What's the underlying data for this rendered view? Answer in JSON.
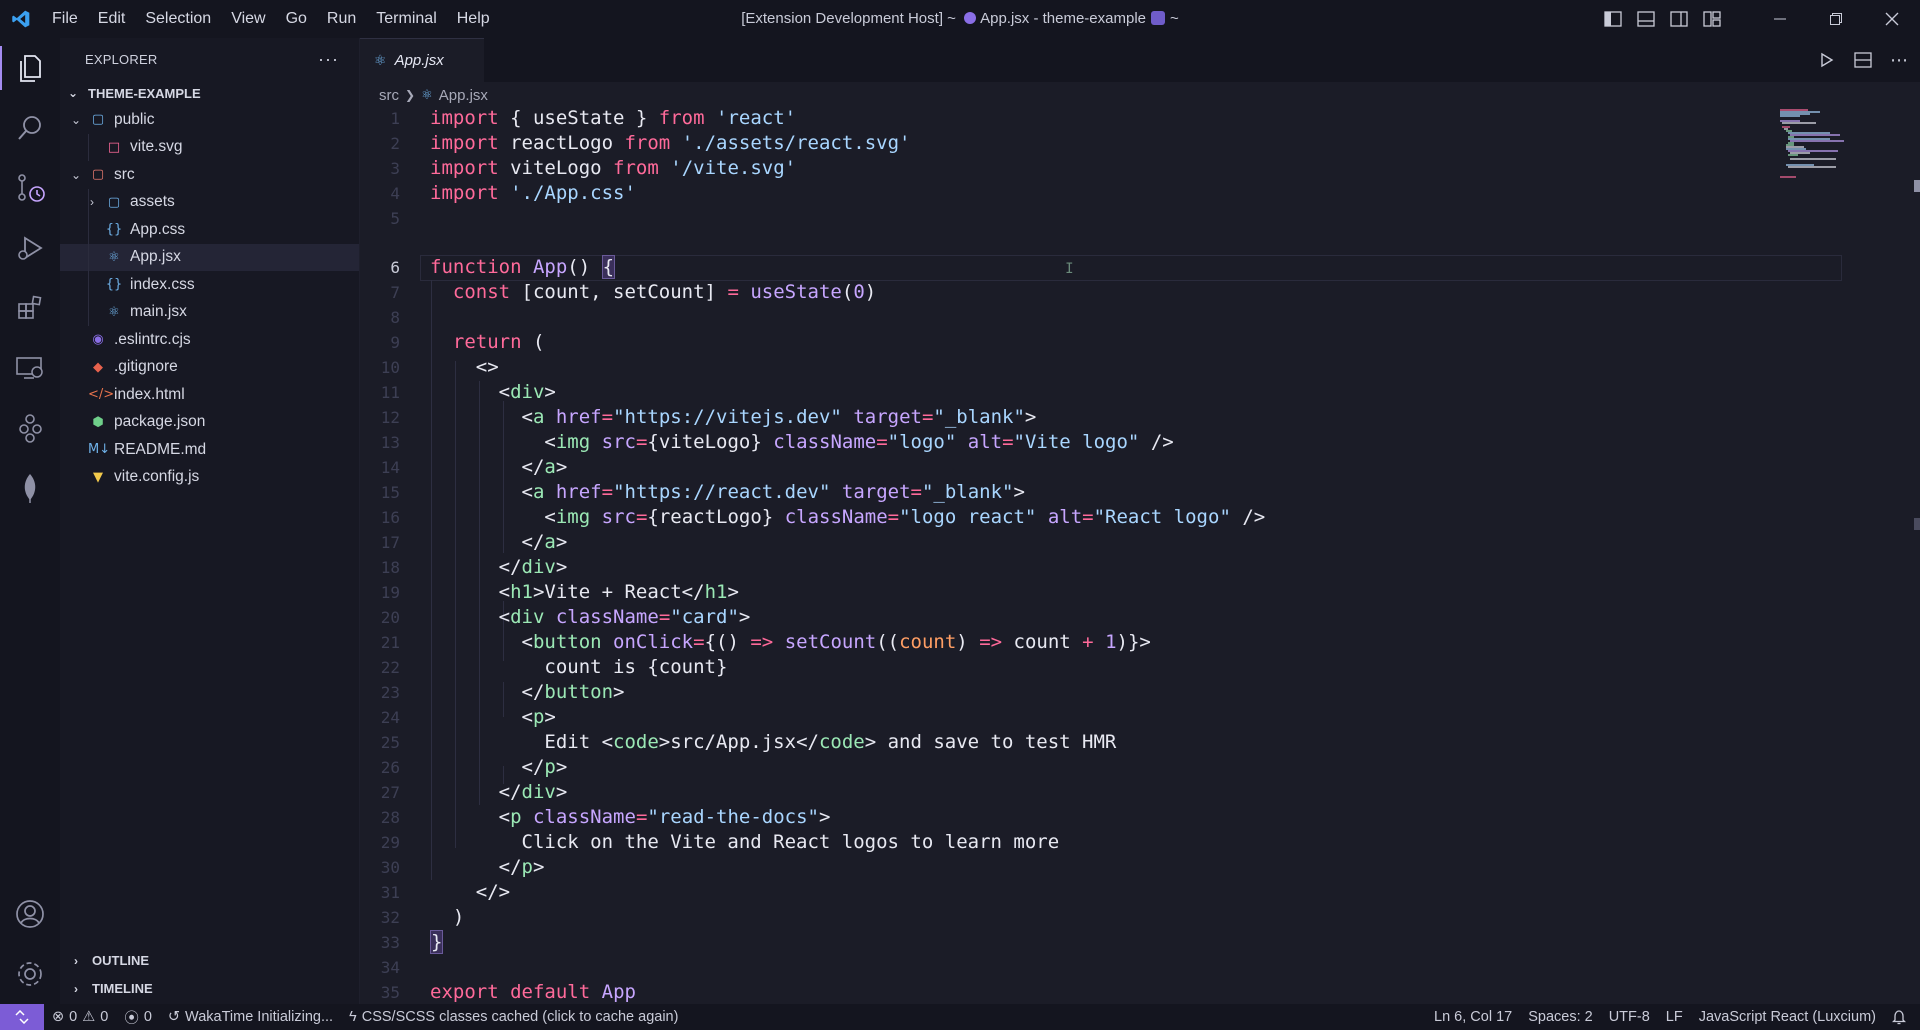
{
  "titlebar": {
    "menu": [
      "File",
      "Edit",
      "Selection",
      "View",
      "Go",
      "Run",
      "Terminal",
      "Help"
    ],
    "title_prefix": "[Extension Development Host] ~",
    "title_main": "App.jsx - theme-example",
    "title_suffix": "~"
  },
  "sidebar": {
    "title": "EXPLORER",
    "more": "···",
    "folder": "THEME-EXAMPLE",
    "tree": [
      {
        "label": "public",
        "kind": "folder-open",
        "depth": 1,
        "icon": "folder-icon"
      },
      {
        "label": "vite.svg",
        "kind": "file",
        "depth": 2,
        "icon": "svg-file-icon"
      },
      {
        "label": "src",
        "kind": "folder-open",
        "depth": 1,
        "icon": "src-folder-icon"
      },
      {
        "label": "assets",
        "kind": "folder-closed",
        "depth": 2,
        "icon": "folder-icon"
      },
      {
        "label": "App.css",
        "kind": "file",
        "depth": 2,
        "icon": "css-file-icon"
      },
      {
        "label": "App.jsx",
        "kind": "file",
        "depth": 2,
        "icon": "react-file-icon",
        "selected": true
      },
      {
        "label": "index.css",
        "kind": "file",
        "depth": 2,
        "icon": "css-file-icon"
      },
      {
        "label": "main.jsx",
        "kind": "file",
        "depth": 2,
        "icon": "react-file-icon"
      },
      {
        "label": ".eslintrc.cjs",
        "kind": "file",
        "depth": 1,
        "icon": "eslint-file-icon"
      },
      {
        "label": ".gitignore",
        "kind": "file",
        "depth": 1,
        "icon": "git-file-icon"
      },
      {
        "label": "index.html",
        "kind": "file",
        "depth": 1,
        "icon": "html-file-icon"
      },
      {
        "label": "package.json",
        "kind": "file",
        "depth": 1,
        "icon": "node-file-icon"
      },
      {
        "label": "README.md",
        "kind": "file",
        "depth": 1,
        "icon": "markdown-file-icon"
      },
      {
        "label": "vite.config.js",
        "kind": "file",
        "depth": 1,
        "icon": "vite-file-icon"
      }
    ],
    "outline": "OUTLINE",
    "timeline": "TIMELINE"
  },
  "editor": {
    "tab": "App.jsx",
    "breadcrumb": [
      "src",
      "App.jsx"
    ],
    "current_line": 6,
    "line_numbers": [
      "1",
      "2",
      "3",
      "4",
      "5",
      "6",
      "7",
      "8",
      "9",
      "10",
      "11",
      "12",
      "13",
      "14",
      "15",
      "16",
      "17",
      "18",
      "19",
      "20",
      "21",
      "22",
      "23",
      "24",
      "25",
      "26",
      "27",
      "28",
      "29",
      "30",
      "31",
      "32",
      "33",
      "34",
      "35"
    ]
  },
  "statusbar": {
    "errors": "0",
    "warnings": "0",
    "ports": "0",
    "wakatime": "WakaTime Initializing...",
    "css_cache": "CSS/SCSS classes cached (click to cache again)",
    "position": "Ln 6, Col 17",
    "spaces": "Spaces: 2",
    "encoding": "UTF-8",
    "eol": "LF",
    "language": "JavaScript React (Luxcium)"
  },
  "colors": {
    "background": "#1b1c27",
    "sidebar": "#171823",
    "accent": "#7c5cd6",
    "keyword": "#ff6a9a",
    "string": "#a9d6ff",
    "function": "#c7a6ff",
    "tag": "#9be8b5"
  }
}
